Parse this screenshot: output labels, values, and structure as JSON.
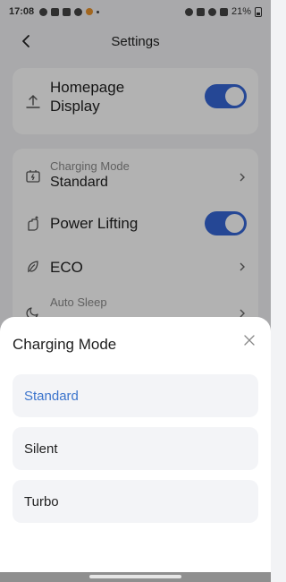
{
  "status_bar": {
    "time": "17:08",
    "battery": "21%"
  },
  "header": {
    "title": "Settings"
  },
  "settings": {
    "homepage_display": {
      "title_line1": "Homepage",
      "title_line2": "Display",
      "enabled": true
    },
    "charging_mode": {
      "label": "Charging Mode",
      "value": "Standard"
    },
    "power_lifting": {
      "title": "Power Lifting",
      "enabled": true
    },
    "eco": {
      "title": "ECO"
    },
    "auto_sleep": {
      "label": "Auto Sleep"
    }
  },
  "sheet": {
    "title": "Charging Mode",
    "options": [
      {
        "label": "Standard",
        "selected": true
      },
      {
        "label": "Silent",
        "selected": false
      },
      {
        "label": "Turbo",
        "selected": false
      }
    ]
  },
  "colors": {
    "accent": "#3566d6",
    "selected_text": "#3b74cc",
    "option_bg": "#f3f4f7"
  },
  "icons": {
    "back": "back-arrow-icon",
    "homepage": "upload-icon",
    "charging": "charging-icon",
    "power_lifting": "hand-lift-icon",
    "eco": "leaf-icon",
    "auto_sleep": "sleep-moon-icon",
    "close": "close-icon"
  }
}
